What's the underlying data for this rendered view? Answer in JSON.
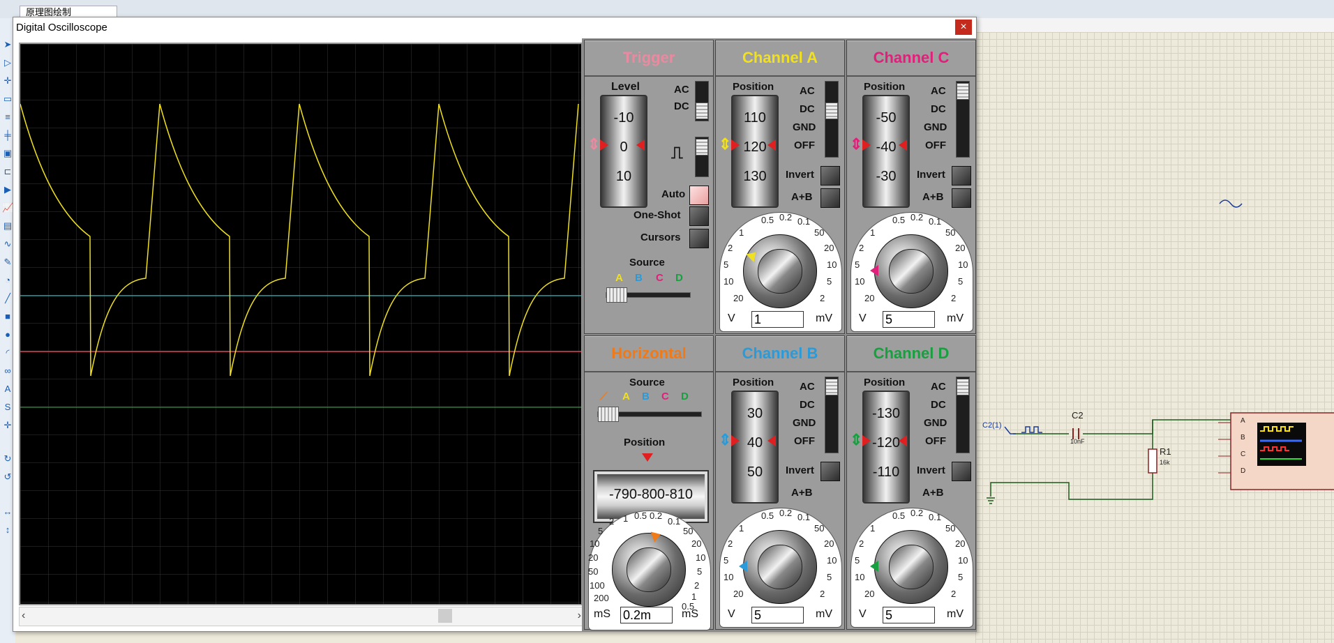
{
  "background": {
    "tab_label": "原理图绘制",
    "schematic": {
      "probe_label": "C2(1)",
      "cap_name": "C2",
      "cap_value": "10nF",
      "res_name": "R1",
      "res_value": "16k",
      "scope_pins": [
        "A",
        "B",
        "C",
        "D"
      ]
    }
  },
  "window": {
    "title": "Digital Oscilloscope",
    "close": "×"
  },
  "trigger": {
    "title": "Trigger",
    "level_label": "Level",
    "wheel": [
      "-10",
      "0",
      "10"
    ],
    "ac": "AC",
    "dc": "DC",
    "auto": "Auto",
    "oneshot": "One-Shot",
    "cursors": "Cursors",
    "source_label": "Source",
    "sources": [
      "A",
      "B",
      "C",
      "D"
    ]
  },
  "channel_a": {
    "title": "Channel A",
    "position_label": "Position",
    "wheel": [
      "110",
      "120",
      "130"
    ],
    "coupling": [
      "AC",
      "DC",
      "GND",
      "OFF"
    ],
    "invert": "Invert",
    "aplusb": "A+B",
    "scale": [
      "0.5",
      "0.2",
      "0.1",
      "50",
      "20",
      "10",
      "5",
      "2",
      "20",
      "10",
      "5",
      "2",
      "1"
    ],
    "unit_left": "V",
    "unit_right": "mV",
    "value": "1"
  },
  "channel_c": {
    "title": "Channel C",
    "position_label": "Position",
    "wheel": [
      "-50",
      "-40",
      "-30"
    ],
    "coupling": [
      "AC",
      "DC",
      "GND",
      "OFF"
    ],
    "invert": "Invert",
    "aplusb": "A+B",
    "scale": [
      "0.5",
      "0.2",
      "0.1",
      "50",
      "20",
      "10",
      "5",
      "2",
      "20",
      "10",
      "5",
      "2",
      "1"
    ],
    "unit_left": "V",
    "unit_right": "mV",
    "value": "5"
  },
  "horizontal": {
    "title": "Horizontal",
    "source_label": "Source",
    "sources": [
      "A",
      "B",
      "C",
      "D"
    ],
    "position_label": "Position",
    "position_readout": "-790-800-810",
    "scale": [
      "1",
      "0.5",
      "0.2",
      "0.1",
      "50",
      "20",
      "10",
      "5",
      "2",
      "1",
      "0.5",
      "2",
      "5",
      "10",
      "20",
      "50",
      "100",
      "200"
    ],
    "unit_left": "mS",
    "unit_right": "mS",
    "value": "0.2m"
  },
  "channel_b": {
    "title": "Channel B",
    "position_label": "Position",
    "wheel": [
      "30",
      "40",
      "50"
    ],
    "coupling": [
      "AC",
      "DC",
      "GND",
      "OFF"
    ],
    "invert": "Invert",
    "aplusb": "A+B",
    "scale": [
      "0.5",
      "0.2",
      "0.1",
      "50",
      "20",
      "10",
      "5",
      "2",
      "20",
      "10",
      "5",
      "2",
      "1"
    ],
    "unit_left": "V",
    "unit_right": "mV",
    "value": "5"
  },
  "channel_d": {
    "title": "Channel D",
    "position_label": "Position",
    "wheel": [
      "-130",
      "-120",
      "-110"
    ],
    "coupling": [
      "AC",
      "DC",
      "GND",
      "OFF"
    ],
    "invert": "Invert",
    "aplusb": "A+B",
    "scale": [
      "0.5",
      "0.2",
      "0.1",
      "50",
      "20",
      "10",
      "5",
      "2",
      "20",
      "10",
      "5",
      "2",
      "1"
    ],
    "unit_left": "V",
    "unit_right": "mV",
    "value": "5"
  },
  "colors": {
    "channel_a": "#f0e020",
    "channel_b": "#2a9bd8",
    "channel_c": "#e0207a",
    "channel_d": "#18a040",
    "trigger": "#e88aa0",
    "horizontal": "#f07a18"
  }
}
